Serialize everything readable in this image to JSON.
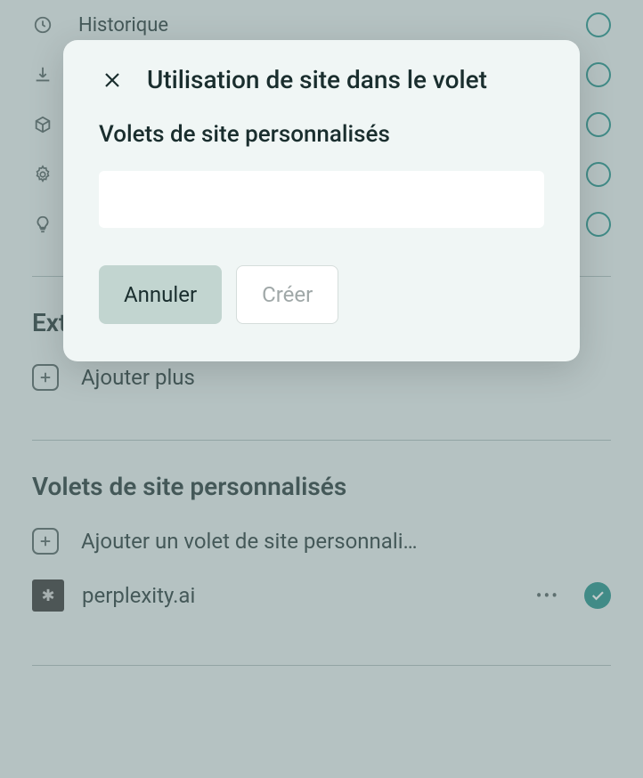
{
  "dialog": {
    "title": "Utilisation de site dans le volet",
    "subtitle": "Volets de site personnalisés",
    "input_value": "",
    "cancel_label": "Annuler",
    "create_label": "Créer"
  },
  "bg_items": {
    "history": "Historique"
  },
  "section_ext": "Ext",
  "add_more": "Ajouter plus",
  "section_custom": "Volets de site personnalisés",
  "add_custom": "Ajouter un volet de site personnali…",
  "site1": "perplexity.ai"
}
